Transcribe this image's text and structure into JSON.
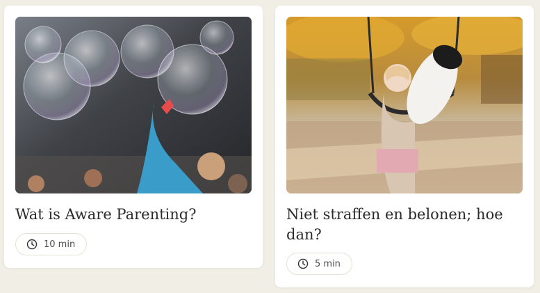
{
  "articles": [
    {
      "title": "Wat is Aware Parenting?",
      "duration": "10 min",
      "image_icon": "bubbles-photo",
      "duration_icon": "clock-icon"
    },
    {
      "title": "Niet straffen en belonen; hoe dan?",
      "duration": "5 min",
      "image_icon": "swing-photo",
      "duration_icon": "clock-icon"
    }
  ],
  "colors": {
    "page_background": "#f1eee5",
    "card_background": "#ffffff",
    "title_text": "#2b2b2b",
    "pill_border": "#e4e1d8"
  }
}
